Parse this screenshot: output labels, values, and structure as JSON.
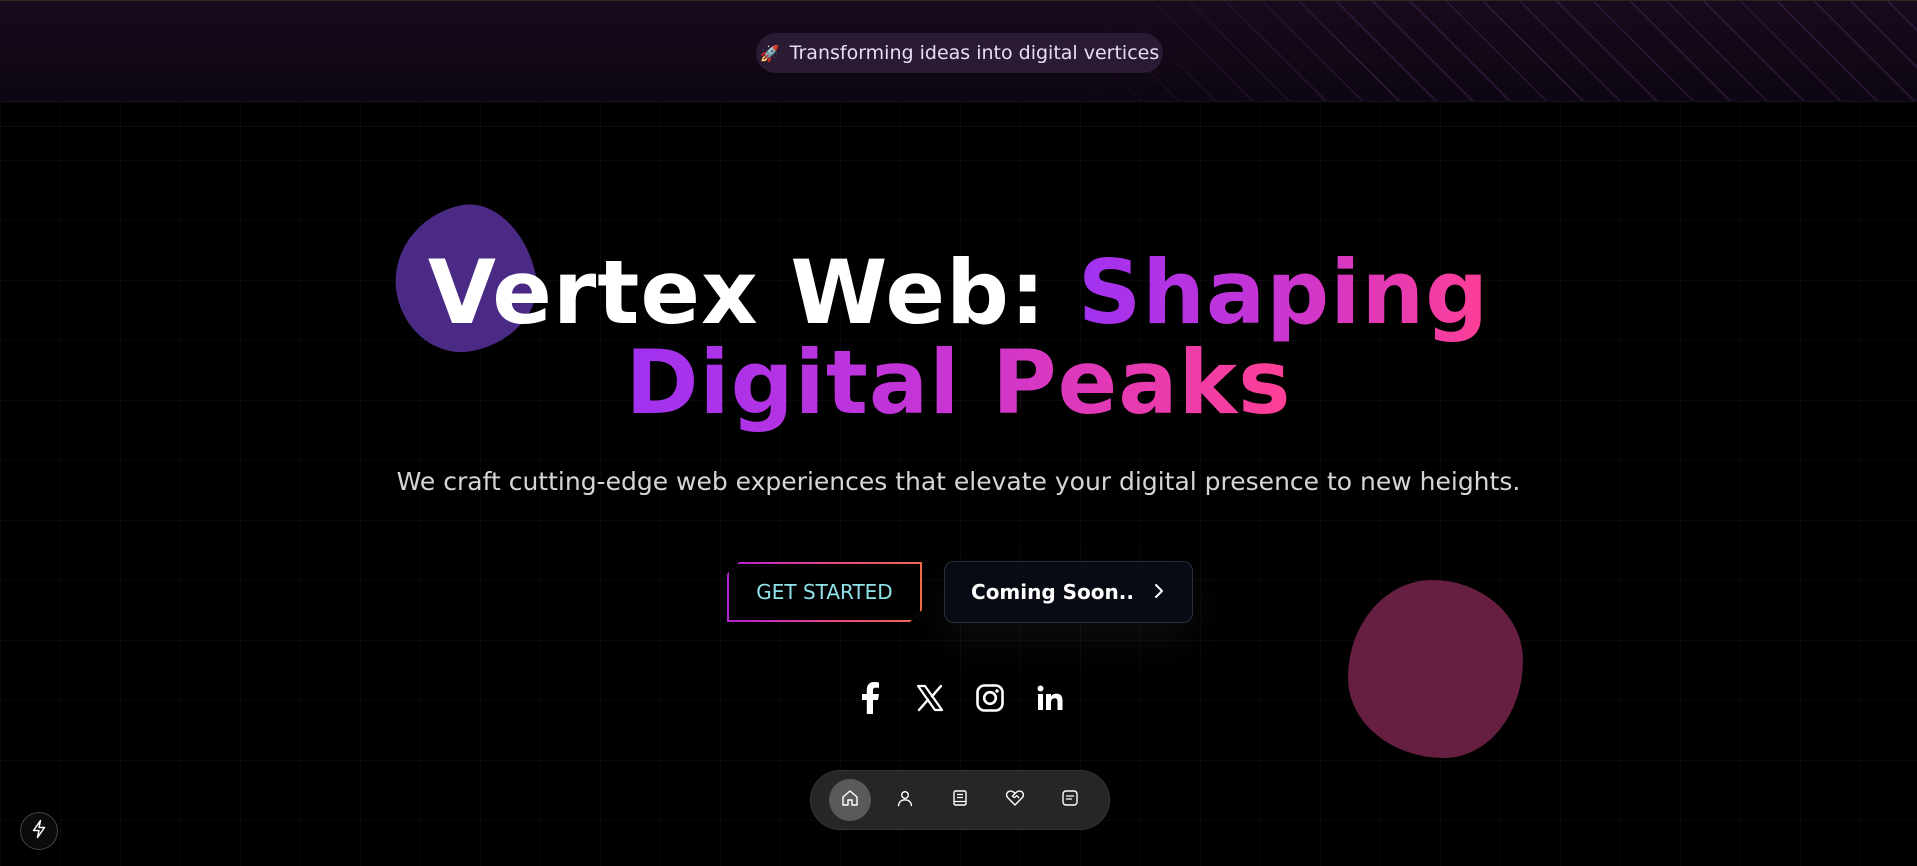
{
  "banner": {
    "rocket": "🚀",
    "text": "Transforming ideas into digital vertices"
  },
  "hero": {
    "title_part1": "Vertex Web: ",
    "title_part2": "Shaping",
    "title_part3": "Digital Peaks",
    "subtitle": "We craft cutting-edge web experiences that elevate your digital presence to new heights."
  },
  "buttons": {
    "get_started": "GET STARTED",
    "coming_soon": "Coming Soon.."
  },
  "socials": [
    {
      "icon": "facebook-icon"
    },
    {
      "icon": "x-icon"
    },
    {
      "icon": "instagram-icon"
    },
    {
      "icon": "linkedin-icon"
    }
  ],
  "dock": {
    "items": [
      "home-icon",
      "user-icon",
      "book-icon",
      "heart-handshake-icon",
      "message-icon"
    ],
    "active": "home-icon"
  },
  "colors": {
    "background": "#000000",
    "gradient_start": "#a032f0",
    "gradient_end": "#ff3f95",
    "get_started_text": "#8fe3e8",
    "blob_purple": "#4a2a85",
    "blob_maroon": "#661f40"
  }
}
